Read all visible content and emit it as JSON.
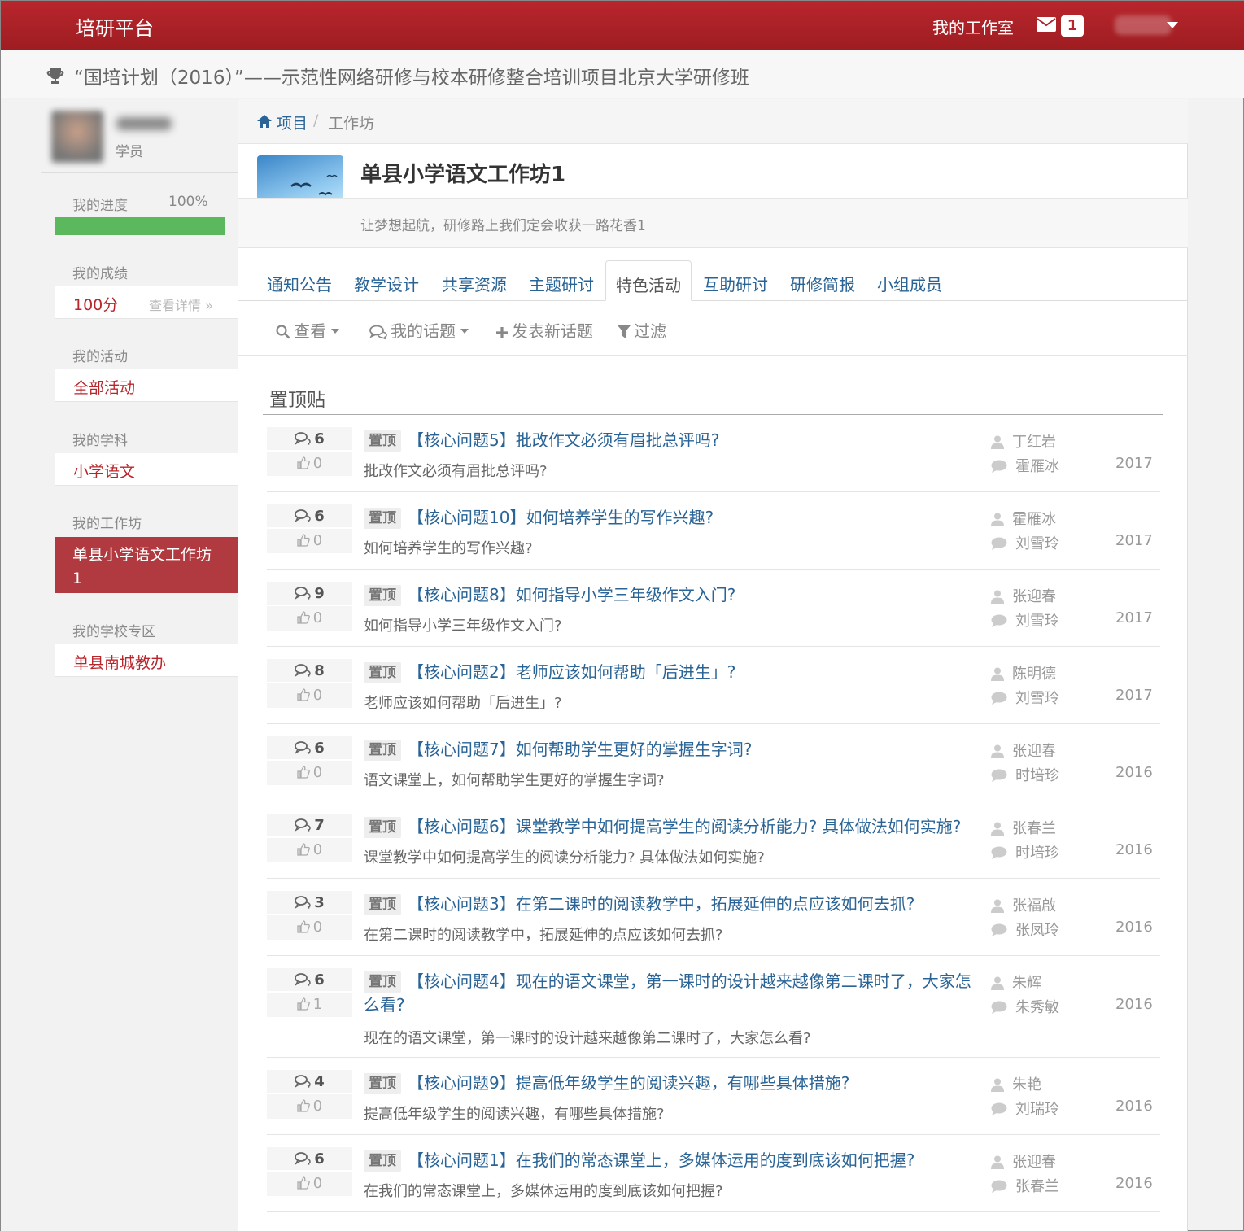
{
  "header": {
    "brand": "培研平台",
    "studio_link": "我的工作室",
    "mail_count": "1"
  },
  "project": {
    "title": "“国培计划（2016）”——示范性网络研修与校本研修整合培训项目北京大学研修班"
  },
  "sidebar": {
    "role": "学员",
    "progress_label": "我的进度",
    "progress_value": "100%",
    "progress_fraction": 1.0,
    "score_label": "我的成绩",
    "score_value": "100分",
    "score_detail": "查看详情 »",
    "activity_label": "我的活动",
    "activity_value": "全部活动",
    "subject_label": "我的学科",
    "subject_value": "小学语文",
    "workshop_label": "我的工作坊",
    "workshop_value": "单县小学语文工作坊1",
    "school_label": "我的学校专区",
    "school_value": "单县南城教办"
  },
  "breadcrumb": {
    "home": "项目",
    "separator": "/",
    "current": "工作坊"
  },
  "workshop": {
    "title": "单县小学语文工作坊1",
    "motto": "让梦想起航，研修路上我们定会收获一路花香1"
  },
  "tabs": [
    {
      "label": "通知公告"
    },
    {
      "label": "教学设计"
    },
    {
      "label": "共享资源"
    },
    {
      "label": "主题研讨"
    },
    {
      "label": "特色活动",
      "active": true
    },
    {
      "label": "互助研讨"
    },
    {
      "label": "研修简报"
    },
    {
      "label": "小组成员"
    }
  ],
  "toolbar": {
    "view": "查看",
    "my_topics": "我的话题",
    "new_topic": "发表新话题",
    "filter": "过滤"
  },
  "pinned": {
    "heading": "置顶贴",
    "tag": "置顶",
    "topics": [
      {
        "replies": "6",
        "likes": "0",
        "title": "【核心问题5】批改作文必须有眉批总评吗?",
        "summary": "批改作文必须有眉批总评吗?",
        "author": "丁红岩",
        "last_reply": "霍雁冰",
        "year": "2017"
      },
      {
        "replies": "6",
        "likes": "0",
        "title": "【核心问题10】如何培养学生的写作兴趣?",
        "summary": "如何培养学生的写作兴趣?",
        "author": "霍雁冰",
        "last_reply": "刘雪玲",
        "year": "2017"
      },
      {
        "replies": "9",
        "likes": "0",
        "title": "【核心问题8】如何指导小学三年级作文入门?",
        "summary": "如何指导小学三年级作文入门?",
        "author": "张迎春",
        "last_reply": "刘雪玲",
        "year": "2017"
      },
      {
        "replies": "8",
        "likes": "0",
        "title": "【核心问题2】老师应该如何帮助「后进生」?",
        "summary": "老师应该如何帮助「后进生」?",
        "author": "陈明德",
        "last_reply": "刘雪玲",
        "year": "2017"
      },
      {
        "replies": "6",
        "likes": "0",
        "title": "【核心问题7】如何帮助学生更好的掌握生字词?",
        "summary": "语文课堂上，如何帮助学生更好的掌握生字词?",
        "author": "张迎春",
        "last_reply": "时培珍",
        "year": "2016"
      },
      {
        "replies": "7",
        "likes": "0",
        "title": "【核心问题6】课堂教学中如何提高学生的阅读分析能力? 具体做法如何实施?",
        "summary": "课堂教学中如何提高学生的阅读分析能力? 具体做法如何实施?",
        "author": "张春兰",
        "last_reply": "时培珍",
        "year": "2016"
      },
      {
        "replies": "3",
        "likes": "0",
        "title": "【核心问题3】在第二课时的阅读教学中，拓展延伸的点应该如何去抓?",
        "summary": "在第二课时的阅读教学中，拓展延伸的点应该如何去抓?",
        "author": "张福啟",
        "last_reply": "张凤玲",
        "year": "2016"
      },
      {
        "replies": "6",
        "likes": "1",
        "title": "【核心问题4】现在的语文课堂，第一课时的设计越来越像第二课时了，大家怎么看?",
        "summary": "现在的语文课堂，第一课时的设计越来越像第二课时了，大家怎么看?",
        "author": "朱辉",
        "last_reply": "朱秀敏",
        "year": "2016",
        "wrap": true
      },
      {
        "replies": "4",
        "likes": "0",
        "title": "【核心问题9】提高低年级学生的阅读兴趣，有哪些具体措施?",
        "summary": "提高低年级学生的阅读兴趣，有哪些具体措施?",
        "author": "朱艳",
        "last_reply": "刘瑞玲",
        "year": "2016"
      },
      {
        "replies": "6",
        "likes": "0",
        "title": "【核心问题1】在我们的常态课堂上，多媒体运用的度到底该如何把握?",
        "summary": "在我们的常态课堂上，多媒体运用的度到底该如何把握?",
        "author": "张迎春",
        "last_reply": "张春兰",
        "year": "2016"
      }
    ]
  },
  "colors": {
    "brand_red": "#b8262c",
    "link_blue": "#2a6496",
    "progress_green": "#5cb85c",
    "active_sidebar": "#b03a3f"
  },
  "icons": [
    "envelope-icon",
    "trophy-icon",
    "home-icon",
    "search-icon",
    "comments-icon",
    "plus-icon",
    "filter-icon",
    "thumbs-up-icon",
    "user-icon",
    "comment-icon"
  ]
}
